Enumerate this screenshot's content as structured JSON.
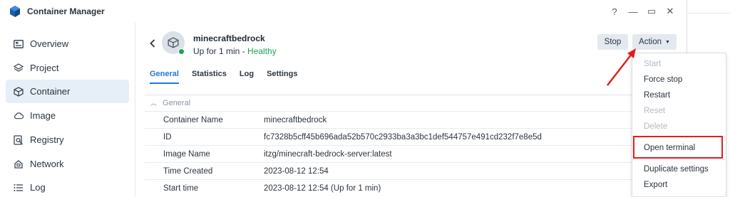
{
  "app": {
    "title": "Container Manager"
  },
  "window_controls": [
    "?",
    "—",
    "▭",
    "✕"
  ],
  "sidebar": {
    "items": [
      {
        "label": "Overview",
        "icon": "overview-icon"
      },
      {
        "label": "Project",
        "icon": "layers-icon"
      },
      {
        "label": "Container",
        "icon": "cube-icon",
        "active": true
      },
      {
        "label": "Image",
        "icon": "cloud-icon"
      },
      {
        "label": "Registry",
        "icon": "registry-search-icon"
      },
      {
        "label": "Network",
        "icon": "network-icon"
      },
      {
        "label": "Log",
        "icon": "list-icon"
      }
    ]
  },
  "container": {
    "name": "minecraftbedrock",
    "status_prefix": "Up for 1 min - ",
    "health": "Healthy"
  },
  "toolbar": {
    "stop_label": "Stop",
    "action_label": "Action"
  },
  "tabs": [
    {
      "label": "General",
      "active": true
    },
    {
      "label": "Statistics"
    },
    {
      "label": "Log"
    },
    {
      "label": "Settings"
    }
  ],
  "section": {
    "title": "General"
  },
  "details": [
    {
      "key": "Container Name",
      "value": "minecraftbedrock"
    },
    {
      "key": "ID",
      "value": "fc7328b5cff45b696ada52b570c2933ba3a3bc1def544757e491cd232f7e8e5d"
    },
    {
      "key": "Image Name",
      "value": "itzg/minecraft-bedrock-server:latest"
    },
    {
      "key": "Time Created",
      "value": "2023-08-12 12:54"
    },
    {
      "key": "Start time",
      "value": "2023-08-12 12:54 (Up for 1 min)"
    }
  ],
  "action_menu": [
    {
      "label": "Start",
      "disabled": true
    },
    {
      "label": "Force stop"
    },
    {
      "label": "Restart"
    },
    {
      "label": "Reset",
      "disabled": true
    },
    {
      "label": "Delete",
      "disabled": true
    },
    {
      "label": "Open terminal",
      "highlighted": true
    },
    {
      "label": "Duplicate settings"
    },
    {
      "label": "Export"
    }
  ],
  "colors": {
    "accent": "#1f7bd8",
    "healthy": "#1aa54f",
    "annotation": "#e02020"
  }
}
